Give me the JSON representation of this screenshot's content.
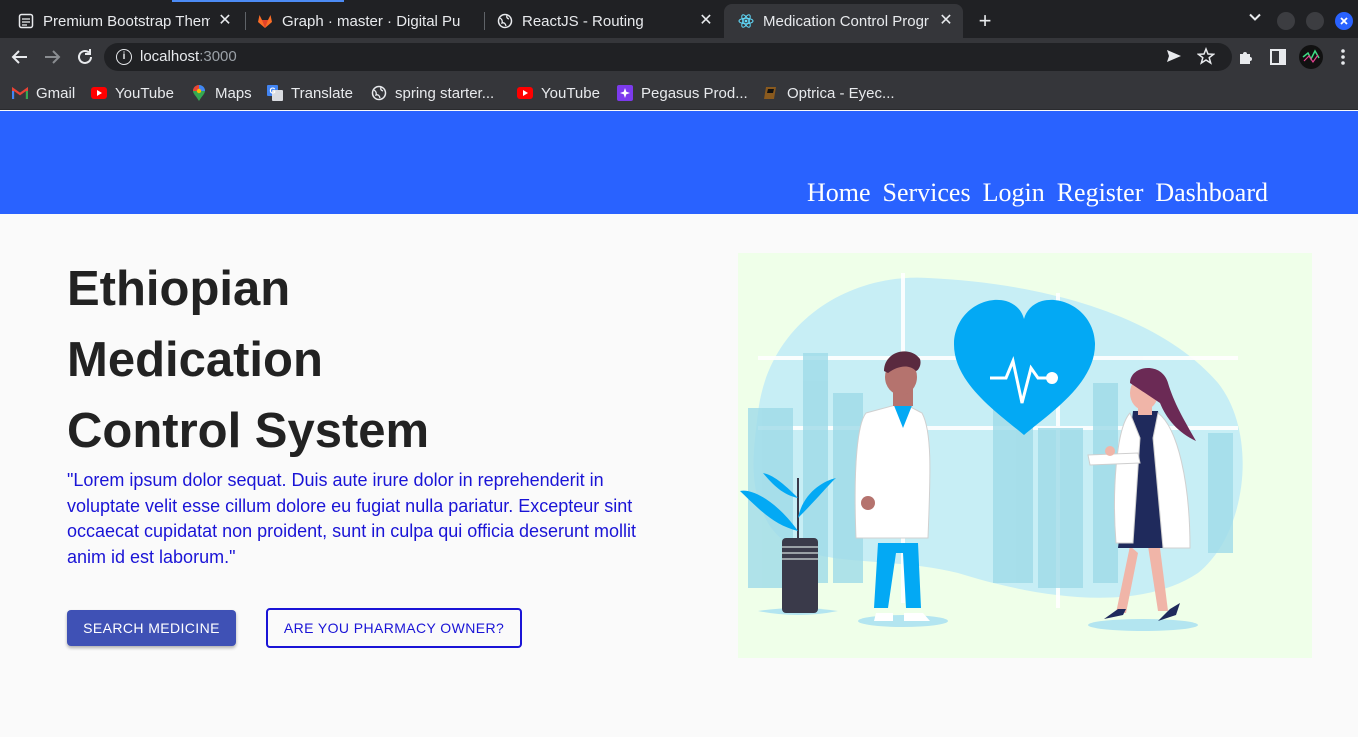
{
  "browser": {
    "tabs": [
      {
        "title": "Premium Bootstrap Theme",
        "icon": "bootstrap-page-icon"
      },
      {
        "title": "Graph · master · Digital Pu",
        "icon": "gitlab-icon"
      },
      {
        "title": "ReactJS - Routing",
        "icon": "globe-icon"
      },
      {
        "title": "Medication Control Progr",
        "icon": "react-icon",
        "active": true
      }
    ],
    "url_host": "localhost",
    "url_port": ":3000",
    "bookmarks": [
      {
        "label": "Gmail",
        "icon": "gmail-icon"
      },
      {
        "label": "YouTube",
        "icon": "youtube-icon"
      },
      {
        "label": "Maps",
        "icon": "maps-icon"
      },
      {
        "label": "Translate",
        "icon": "translate-icon"
      },
      {
        "label": "spring starter...",
        "icon": "globe-icon"
      },
      {
        "label": "YouTube",
        "icon": "youtube-icon"
      },
      {
        "label": "Pegasus Prod...",
        "icon": "pegasus-icon"
      },
      {
        "label": "Optrica - Eyec...",
        "icon": "optrica-icon"
      }
    ]
  },
  "nav": {
    "links": [
      "Home",
      "Services",
      "Login",
      "Register",
      "Dashboard"
    ]
  },
  "hero": {
    "title_lines": [
      "Ethiopian",
      "Medication",
      "Control System"
    ],
    "text": "\"Lorem ipsum dolor sequat. Duis aute irure dolor in reprehenderit in voluptate velit esse cillum dolore eu fugiat nulla pariatur. Excepteur sint occaecat cupidatat non proident, sunt in culpa qui officia deserunt mollit anim id est laborum.\"",
    "primary_button": "SEARCH MEDICINE",
    "secondary_button": "ARE YOU PHARMACY OWNER?"
  },
  "colors": {
    "navbar": "#2962ff",
    "primary_button": "#3f51b5",
    "accent_text": "#1a14d6",
    "illustration_bg": "#efffe9",
    "heart": "#03a9f4"
  }
}
